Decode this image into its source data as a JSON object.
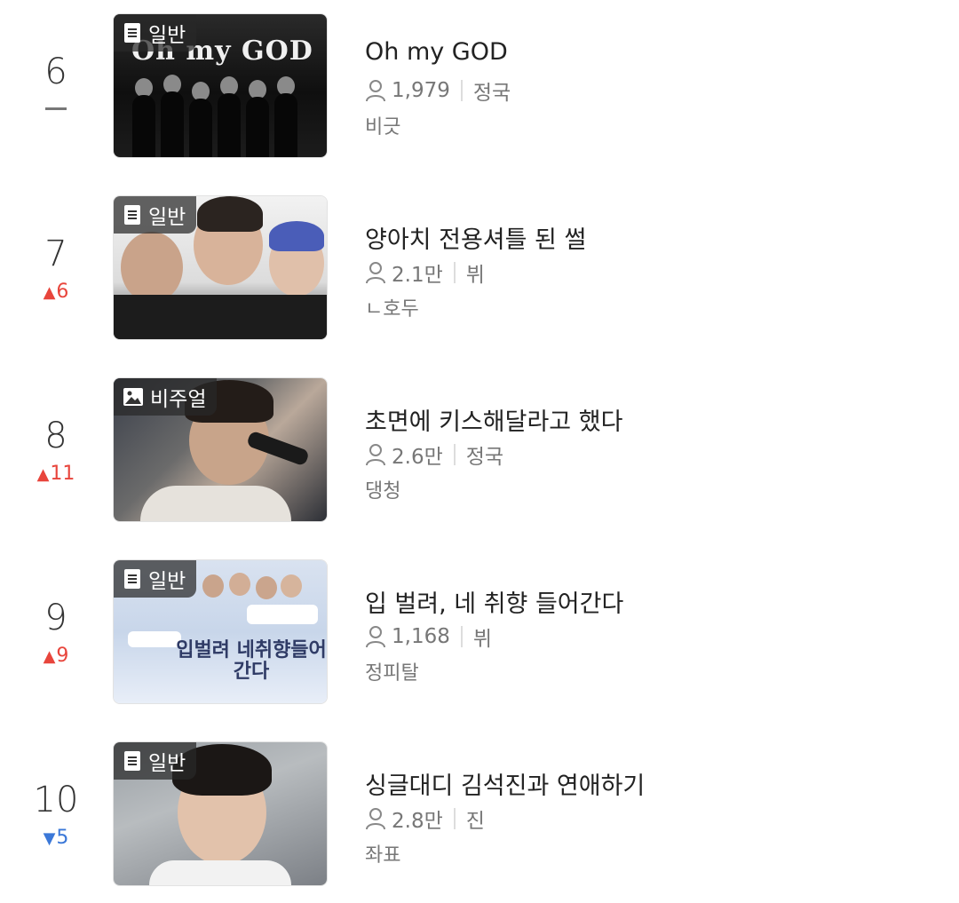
{
  "items": [
    {
      "rank": "6",
      "change": {
        "dir": "same",
        "value": ""
      },
      "badge": "일반",
      "badge_icon": "document-icon",
      "title": "Oh my GOD",
      "views": "1,979",
      "member": "정국",
      "author": "비긋"
    },
    {
      "rank": "7",
      "change": {
        "dir": "up",
        "value": "6"
      },
      "badge": "일반",
      "badge_icon": "document-icon",
      "title": "양아치 전용셔틀 된 썰",
      "views": "2.1만",
      "member": "뷔",
      "author": "ㄴ호두"
    },
    {
      "rank": "8",
      "change": {
        "dir": "up",
        "value": "11"
      },
      "badge": "비주얼",
      "badge_icon": "image-icon",
      "title": "초면에 키스해달라고 했다",
      "views": "2.6만",
      "member": "정국",
      "author": "댕청"
    },
    {
      "rank": "9",
      "change": {
        "dir": "up",
        "value": "9"
      },
      "badge": "일반",
      "badge_icon": "document-icon",
      "title": "입 벌려, 네 취향 들어간다",
      "views": "1,168",
      "member": "뷔",
      "author": "정피탈"
    },
    {
      "rank": "10",
      "change": {
        "dir": "down",
        "value": "5"
      },
      "badge": "일반",
      "badge_icon": "document-icon",
      "title": "싱글대디 김석진과 연애하기",
      "views": "2.8만",
      "member": "진",
      "author": "좌표"
    }
  ],
  "thumb_texts": {
    "t1_logo": "Oh my GOD",
    "t4_text": "입벌려 네취향들어 간다"
  },
  "colors": {
    "up": "#e8453c",
    "down": "#3b78d8",
    "text": "#222222",
    "meta": "#777777"
  }
}
